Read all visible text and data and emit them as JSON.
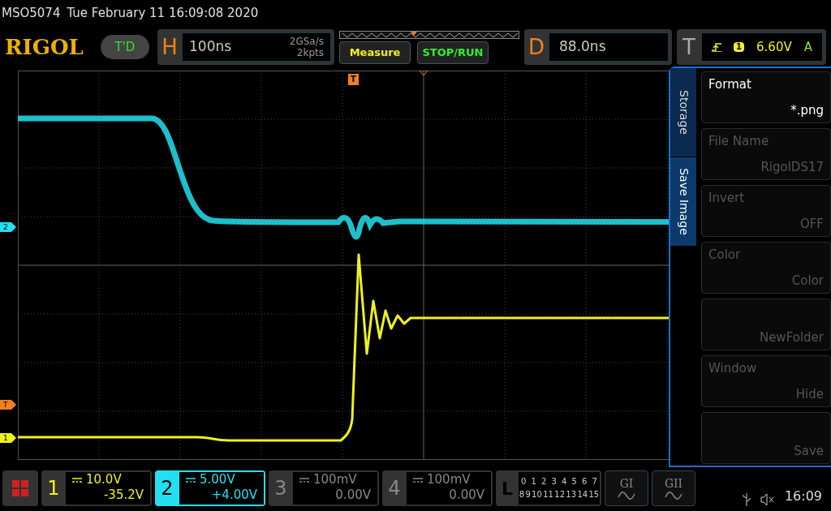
{
  "title_bar": {
    "model": "MSO5074",
    "datetime": "Tue February 11 16:09:08 2020"
  },
  "top_bar": {
    "logo": "RIGOL",
    "run_state": "T'D",
    "horizontal": {
      "letter": "H",
      "timebase": "100ns",
      "sample_rate": "2GSa/s",
      "memory_depth": "2kpts"
    },
    "measure_button": "Measure",
    "stop_run_button": "STOP/RUN",
    "delay": {
      "letter": "D",
      "value": "88.0ns"
    },
    "trigger": {
      "letter": "T",
      "source": "1",
      "level": "6.60V",
      "mode": "A"
    }
  },
  "markers": [
    {
      "label": "2",
      "color": "#22e0f0"
    },
    {
      "label": "T",
      "color": "#f08020"
    },
    {
      "label": "1",
      "color": "#f0f020"
    }
  ],
  "trigger_marker": "T",
  "menu": {
    "tabs": [
      {
        "label": "Storage",
        "selected": false
      },
      {
        "label": "Save Image",
        "selected": true
      }
    ],
    "items": [
      {
        "label": "Format",
        "value": "*.png",
        "disabled": false
      },
      {
        "label": "File Name",
        "value": "RigolDS17",
        "disabled": true
      },
      {
        "label": "Invert",
        "value": "OFF",
        "disabled": true
      },
      {
        "label": "Color",
        "value": "Color",
        "disabled": true
      },
      {
        "value": "NewFolder",
        "disabled": true
      },
      {
        "label": "Window",
        "value": "Hide",
        "disabled": true
      },
      {
        "value": "Save",
        "disabled": true
      }
    ]
  },
  "channels": [
    {
      "number": "1",
      "scale": "10.0V",
      "offset": "-35.2V",
      "on": true,
      "selected": false,
      "color": "#f0f020"
    },
    {
      "number": "2",
      "scale": "5.00V",
      "offset": "+4.00V",
      "on": true,
      "selected": true,
      "color": "#22e0f0"
    },
    {
      "number": "3",
      "scale": "100mV",
      "offset": "0.00V",
      "on": false,
      "selected": false
    },
    {
      "number": "4",
      "scale": "100mV",
      "offset": "0.00V",
      "on": false,
      "selected": false
    }
  ],
  "logic": {
    "letter": "L",
    "row_1": [
      "0",
      "1",
      "2",
      "3",
      "4",
      "5",
      "6",
      "7"
    ],
    "row_2": [
      "8",
      "9",
      "10",
      "11",
      "12",
      "13",
      "14",
      "15"
    ]
  },
  "generators": [
    "GI",
    "GII"
  ],
  "clock": "16:09"
}
